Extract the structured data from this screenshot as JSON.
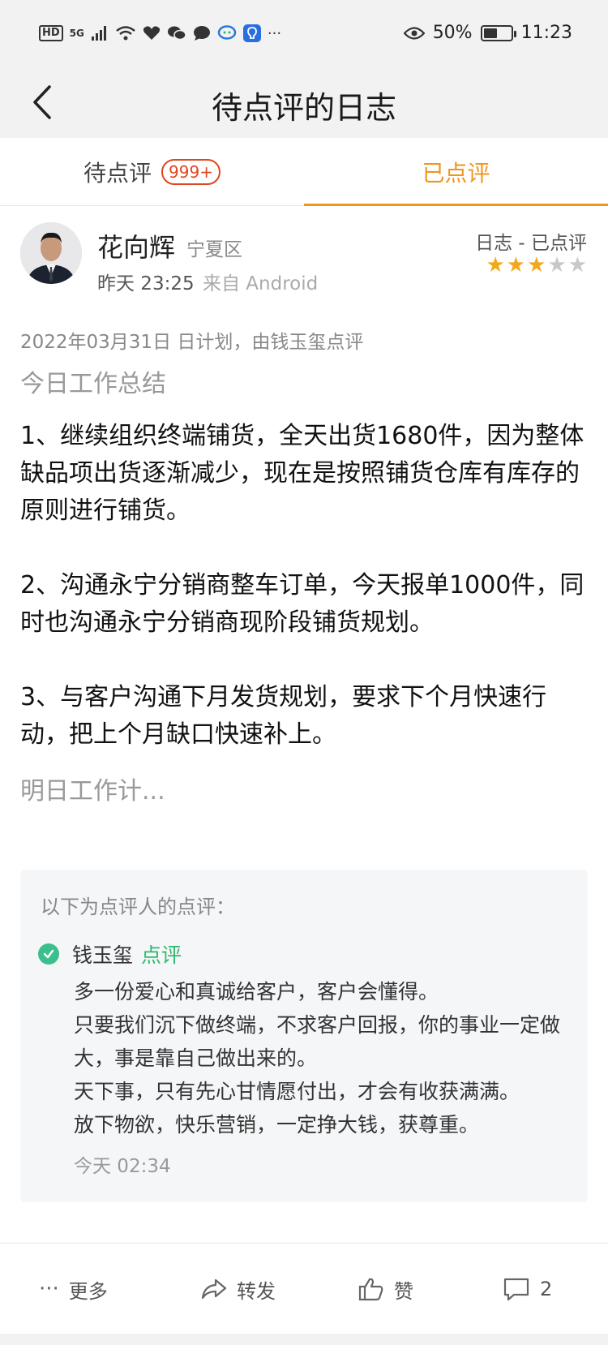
{
  "status_bar": {
    "hd": "HD",
    "network": "5G",
    "battery_text": "50%",
    "battery_level": 0.5,
    "time": "11:23",
    "more_dots": "···"
  },
  "nav": {
    "title": "待点评的日志"
  },
  "tabs": {
    "pending_label": "待点评",
    "pending_badge": "999+",
    "reviewed_label": "已点评",
    "active": "reviewed"
  },
  "post": {
    "author_name": "花向辉",
    "region": "宁夏区",
    "time": "昨天 23:25",
    "source": "来自 Android",
    "status": "日志 - 已点评",
    "rating": 3,
    "rating_max": 5,
    "meta": "2022年03月31日 日计划，由钱玉玺点评",
    "section_today": "今日工作总结",
    "paragraphs": [
      "1、继续组织终端铺货，全天出货1680件，因为整体缺品项出货逐渐减少，现在是按照铺货仓库有库存的原则进行铺货。",
      "2、沟通永宁分销商整车订单，今天报单1000件，同时也沟通永宁分销商现阶段铺货规划。",
      "3、与客户沟通下月发货规划，要求下个月快速行动，把上个月缺口快速补上。"
    ],
    "section_tomorrow": "明日工作计..."
  },
  "review": {
    "header": "以下为点评人的点评：",
    "reviewer": "钱玉玺",
    "action": "点评",
    "lines": [
      "多一份爱心和真诚给客户，客户会懂得。",
      "只要我们沉下做终端，不求客户回报，你的事业一定做大，事是靠自己做出来的。",
      "天下事，只有先心甘情愿付出，才会有收获满满。",
      "放下物欲，快乐营销，一定挣大钱，获尊重。"
    ],
    "time": "今天 02:34"
  },
  "actions": {
    "more_dots": "···",
    "more": "更多",
    "share": "转发",
    "like": "赞",
    "comment_count": "2"
  },
  "colors": {
    "accent": "#f0961e",
    "badge": "#e0461f",
    "star": "#f3a81b",
    "review_green": "#2fb86f"
  }
}
